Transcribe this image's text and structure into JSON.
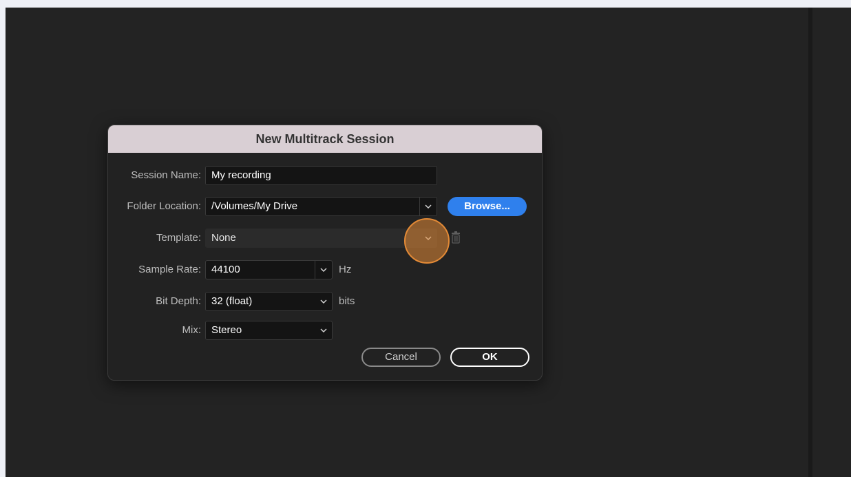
{
  "dialog": {
    "title": "New Multitrack Session",
    "session_name": {
      "label": "Session Name:",
      "value": "My recording"
    },
    "folder_location": {
      "label": "Folder Location:",
      "value": "/Volumes/My Drive",
      "browse_label": "Browse..."
    },
    "template": {
      "label": "Template:",
      "value": "None"
    },
    "sample_rate": {
      "label": "Sample Rate:",
      "value": "44100",
      "unit": "Hz"
    },
    "bit_depth": {
      "label": "Bit Depth:",
      "value": "32 (float)",
      "unit": "bits"
    },
    "mix": {
      "label": "Mix:",
      "value": "Stereo"
    },
    "cancel_label": "Cancel",
    "ok_label": "OK"
  },
  "colors": {
    "accent": "#2f80ed",
    "titlebar": "#d9cfd4",
    "click_marker": "#e38a36"
  },
  "icons": {
    "dropdown": "chevron-down-icon",
    "delete": "trash-icon"
  }
}
